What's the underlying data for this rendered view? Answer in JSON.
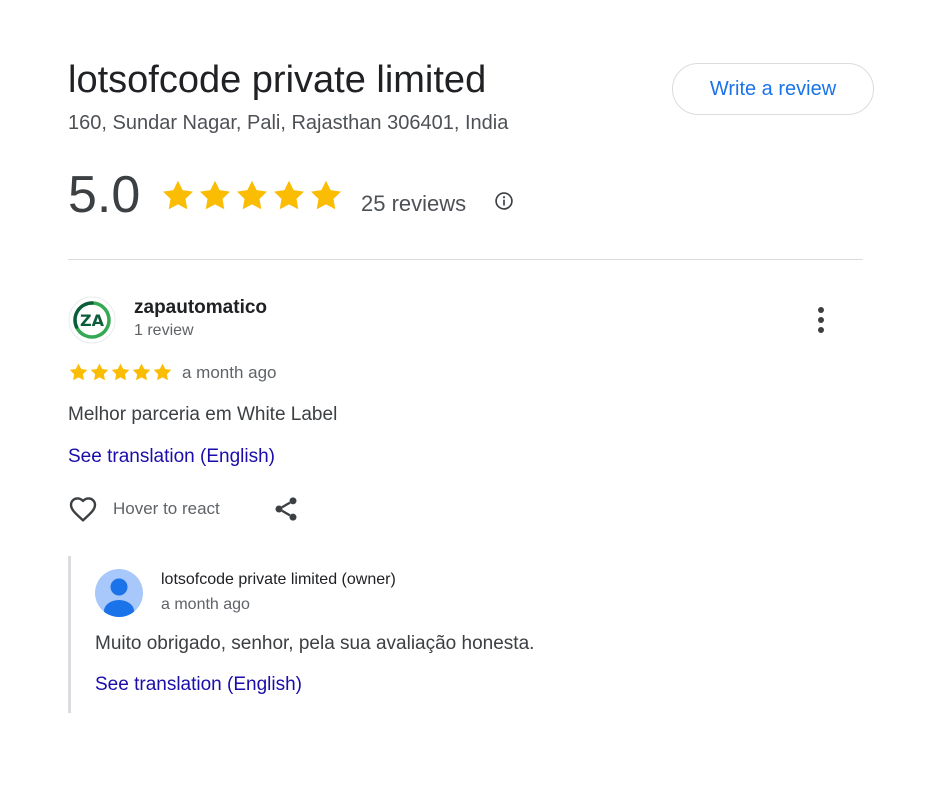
{
  "business": {
    "name": "lotsofcode private limited",
    "address": "160, Sundar Nagar, Pali, Rajasthan 306401, India",
    "write_review_label": "Write a review",
    "rating": "5.0",
    "stars": 5,
    "reviews_count": "25 reviews"
  },
  "review": {
    "author": "zapautomatico",
    "author_avatar_text": "ZA",
    "author_meta": "1 review",
    "stars": 5,
    "time": "a month ago",
    "text": "Melhor parceria em White Label",
    "translate_label": "See translation (English)",
    "react_label": "Hover to react"
  },
  "reply": {
    "author": "lotsofcode private limited (owner)",
    "time": "a month ago",
    "text": "Muito obrigado, senhor, pela sua avaliação honesta.",
    "translate_label": "See translation (English)"
  },
  "colors": {
    "star": "#fbbc04",
    "link": "#1a0dab",
    "accent": "#1a73e8",
    "za_green": "#34a853",
    "za_dark": "#0d5c3a"
  }
}
